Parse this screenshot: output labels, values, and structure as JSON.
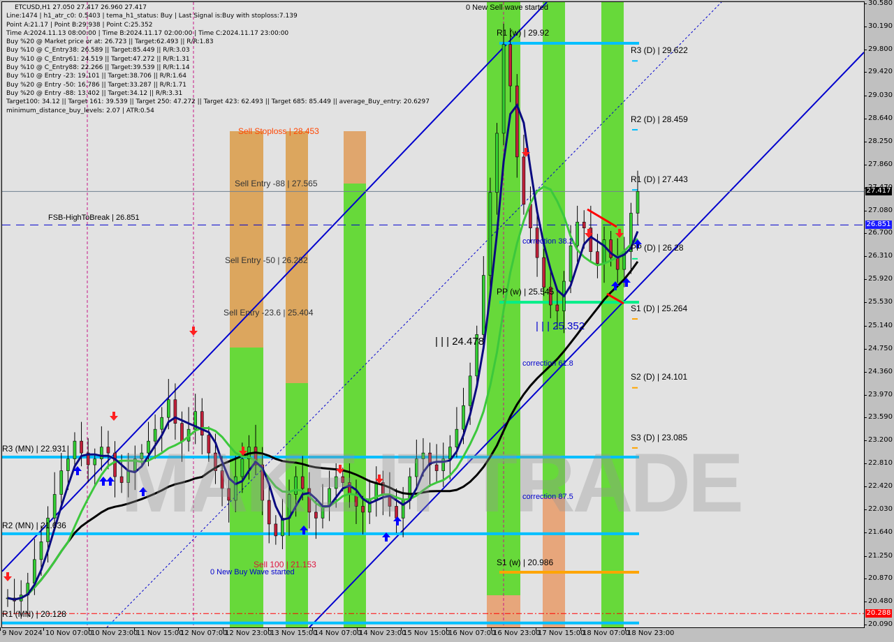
{
  "chart_data": {
    "type": "candlestick",
    "title": "ETCUSD,H1  27.050 27.417 26.960 27.417",
    "symbol": "ETCUSD",
    "timeframe": "H1",
    "ohlc_last": {
      "open": 27.05,
      "high": 27.417,
      "low": 26.96,
      "close": 27.417
    },
    "ylim": [
      20.09,
      30.58
    ],
    "y_ticks": [
      "30.580",
      "30.190",
      "29.800",
      "29.420",
      "29.030",
      "28.640",
      "28.250",
      "27.860",
      "27.470",
      "27.080",
      "26.700",
      "26.310",
      "25.920",
      "25.530",
      "25.140",
      "24.750",
      "24.360",
      "23.970",
      "23.590",
      "23.200",
      "22.810",
      "22.420",
      "22.030",
      "21.640",
      "21.250",
      "20.870",
      "20.480",
      "20.090"
    ],
    "x_ticks": [
      "9 Nov 2024",
      "10 Nov 07:00",
      "10 Nov 23:00",
      "11 Nov 15:00",
      "12 Nov 07:00",
      "12 Nov 23:00",
      "13 Nov 15:00",
      "14 Nov 07:00",
      "14 Nov 23:00",
      "15 Nov 15:00",
      "16 Nov 07:00",
      "16 Nov 23:00",
      "17 Nov 15:00",
      "18 Nov 07:00",
      "18 Nov 23:00"
    ],
    "current_price": {
      "value": 27.417,
      "label": "27.417"
    },
    "fsb_price": {
      "value": 26.851,
      "label": "26.851"
    },
    "red_level": {
      "value": 20.288,
      "label": "20.288"
    },
    "info_lines": [
      "Line:1474 | h1_atr_c0: 0.5403 | tema_h1_status: Buy | Last Signal is:Buy with stoploss:7.139",
      "Point A:21.17 | Point B:29.938 | Point C:25.352",
      "Time A:2024.11.13 08:00:00 | Time B:2024.11.17 02:00:00 | Time C:2024.11.17 23:00:00",
      "Buy %20 @ Market price or at: 26.723 || Target:62.493 || R/R:1.83",
      "Buy %10 @ C_Entry38: 26.589 || Target:85.449 || R/R:3.03",
      "Buy %10 @ C_Entry61: 24.519 || Target:47.272 || R/R:1.31",
      "Buy %10 @ C_Entry88: 22.266 || Target:39.539 || R/R:1.14",
      "Buy %10 @ Entry -23: 19.101 || Target:38.706 || R/R:1.64",
      "Buy %20 @ Entry -50: 16.786 || Target:33.287 || R/R:1.71",
      "Buy %20 @ Entry -88: 13.402 || Target:34.12 || R/R:3.31",
      "Target100: 34.12 || Target 161: 39.539 || Target 250: 47.272 || Target 423: 62.493 || Target 685: 85.449 || average_Buy_entry: 20.6297",
      "minimum_distance_buy_levels: 2.07 | ATR:0.54"
    ],
    "levels": [
      {
        "label": "R1 (MN) | 20.128",
        "value": 20.128,
        "color": "#00bfff"
      },
      {
        "label": "R2 (MN) | 21.636",
        "value": 21.636,
        "color": "#00bfff"
      },
      {
        "label": "R3 (MN) | 22.931",
        "value": 22.931,
        "color": "#00bfff"
      },
      {
        "label": "R1 (w) | 29.92",
        "value": 29.92,
        "color": "#00bfff"
      },
      {
        "label": "PP (w) | 25.545",
        "value": 25.545,
        "color": "#00ee88"
      },
      {
        "label": "S1 (w) | 20.986",
        "value": 20.986,
        "color": "#ffa500"
      },
      {
        "label": "R3 (D) | 29.622",
        "value": 29.622,
        "color": "#00bfff"
      },
      {
        "label": "R2 (D) | 28.459",
        "value": 28.459,
        "color": "#00bfff"
      },
      {
        "label": "R1 (D) | 27.443",
        "value": 27.443,
        "color": "#00bfff"
      },
      {
        "label": "PP (D) | 26.28",
        "value": 26.28,
        "color": "#00ee88"
      },
      {
        "label": "S1 (D) | 25.264",
        "value": 25.264,
        "color": "#ffa500"
      },
      {
        "label": "S2 (D) | 24.101",
        "value": 24.101,
        "color": "#ffa500"
      },
      {
        "label": "S3 (D) | 23.085",
        "value": 23.085,
        "color": "#ffa500"
      }
    ],
    "sell_levels": [
      {
        "label": "Sell Stoploss | 28.453",
        "value": 28.453,
        "color": "#ff4500"
      },
      {
        "label": "Sell Entry -88 | 27.565",
        "value": 27.565,
        "color": "#333333"
      },
      {
        "label": "Sell Entry -50 | 26.282",
        "value": 26.282,
        "color": "#333333"
      },
      {
        "label": "Sell Entry -23.6 | 25.404",
        "value": 25.404,
        "color": "#333333"
      },
      {
        "label": "Sell 100 | 21.153",
        "value": 21.153,
        "color": "#dc143c"
      }
    ],
    "annotations": [
      {
        "text": "FSB-HighToBreak | 26.851",
        "value": 26.851
      },
      {
        "text": "0 New Sell wave started"
      },
      {
        "text": "0 New Buy Wave started"
      },
      {
        "text": "correction 38.2"
      },
      {
        "text": "correction 61.8"
      },
      {
        "text": "correction 87.5"
      },
      {
        "text": "| | | 24.478",
        "value": 24.478
      },
      {
        "text": "| | | 25.352",
        "value": 25.352
      }
    ],
    "watermark": "MAKE IT TRADE",
    "closes": [
      20.55,
      20.5,
      20.6,
      20.8,
      21.2,
      21.5,
      21.9,
      22.3,
      22.7,
      22.9,
      23.2,
      23.0,
      22.8,
      22.9,
      23.1,
      23.0,
      22.6,
      22.5,
      22.7,
      22.9,
      23.0,
      23.2,
      23.4,
      23.6,
      23.9,
      23.5,
      23.2,
      23.4,
      23.7,
      23.3,
      23.0,
      22.7,
      22.4,
      22.2,
      22.6,
      22.9,
      23.1,
      22.8,
      22.2,
      21.8,
      21.6,
      21.9,
      22.3,
      22.6,
      22.4,
      22.0,
      21.9,
      22.1,
      22.4,
      22.6,
      22.5,
      22.3,
      22.1,
      22.0,
      22.2,
      22.5,
      22.3,
      22.1,
      21.9,
      22.2,
      22.6,
      22.9,
      23.0,
      22.8,
      22.7,
      22.9,
      23.1,
      23.4,
      23.8,
      24.3,
      25.0,
      26.0,
      27.4,
      28.4,
      29.9,
      29.2,
      28.0,
      27.2,
      26.8,
      26.3,
      25.8,
      25.5,
      25.4,
      25.9,
      26.5,
      26.9,
      26.8,
      26.4,
      26.2,
      26.6,
      26.3,
      26.1,
      26.4,
      27.05,
      27.417
    ]
  }
}
